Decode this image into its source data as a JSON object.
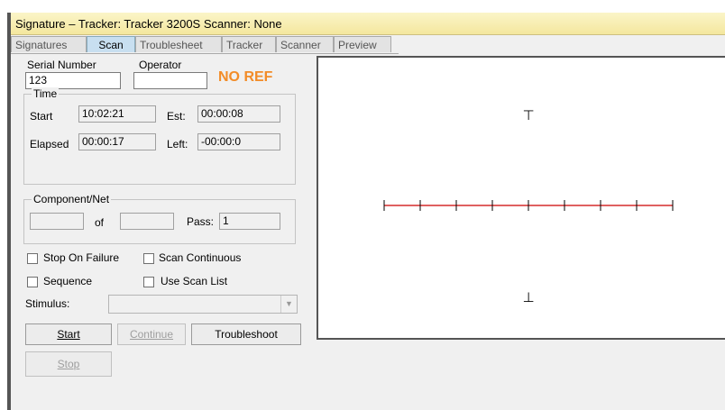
{
  "window": {
    "title": "Signature – Tracker: Tracker 3200S  Scanner: None"
  },
  "tabs": [
    {
      "label": "Signatures",
      "active": false
    },
    {
      "label": "Scan",
      "active": true
    },
    {
      "label": "Troublesheet",
      "active": false
    },
    {
      "label": "Tracker",
      "active": false
    },
    {
      "label": "Scanner",
      "active": false
    },
    {
      "label": "Preview",
      "active": false
    }
  ],
  "scan": {
    "serial_label": "Serial Number",
    "serial_value": "123",
    "operator_label": "Operator",
    "operator_value": "",
    "status_text": "NO REF",
    "status_color": "#f28c28",
    "time": {
      "group_label": "Time",
      "start_label": "Start",
      "start_value": "10:02:21",
      "est_label": "Est:",
      "est_value": "00:00:08",
      "elapsed_label": "Elapsed",
      "elapsed_value": "00:00:17",
      "left_label": "Left:",
      "left_value": "-00:00:0"
    },
    "component": {
      "group_label": "Component/Net",
      "component_value": "",
      "of_label": "of",
      "total_value": "",
      "pass_label": "Pass:",
      "pass_value": "1"
    },
    "options": {
      "stop_on_failure": {
        "label": "Stop On Failure",
        "checked": false
      },
      "scan_continuous": {
        "label": "Scan Continuous",
        "checked": false
      },
      "sequence": {
        "label": "Sequence",
        "checked": false
      },
      "use_scan_list": {
        "label": "Use Scan List",
        "checked": false
      }
    },
    "stimulus_label": "Stimulus:",
    "stimulus_value": "",
    "buttons": {
      "start": "Start",
      "continue": "Continue",
      "troubleshoot": "Troubleshoot",
      "stop": "Stop"
    }
  },
  "signature_view": {
    "trace_color": "#cc0000",
    "top_marker": "⊤",
    "bottom_marker": "⊥"
  }
}
